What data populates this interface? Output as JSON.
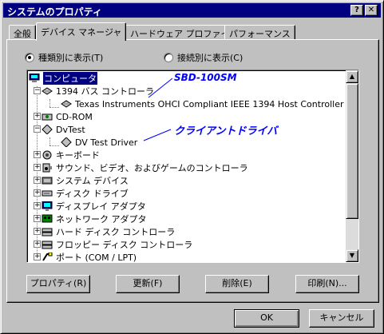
{
  "window": {
    "title": "システムのプロパティ",
    "help_btn": "?",
    "close_btn": "✕"
  },
  "tabs": [
    "全般",
    "デバイス マネージャ",
    "ハードウェア プロファイル",
    "パフォーマンス"
  ],
  "view": {
    "by_type": "種類別に表示(T)",
    "by_connection": "接続別に表示(C)"
  },
  "tree": {
    "root": "コンピュータ",
    "bus1394": "1394 バス コントローラ",
    "ti_controller": "Texas Instruments OHCI Compliant IEEE 1394 Host Controller",
    "cdrom": "CD-ROM",
    "dvtest": "DvTest",
    "dv_driver": "DV Test Driver",
    "keyboard": "キーボード",
    "sound": "サウンド、ビデオ、およびゲームのコントローラ",
    "system": "システム デバイス",
    "disk": "ディスク ドライブ",
    "display": "ディスプレイ アダプタ",
    "network": "ネットワーク アダプタ",
    "hdd_ctrl": "ハード ディスク コントローラ",
    "fdd_ctrl": "フロッピー ディスク コントローラ",
    "port": "ポート (COM / LPT)"
  },
  "annotations": {
    "sbd": "SBD-100SM",
    "client_driver": "クライアントドライバ"
  },
  "actions": {
    "properties": "プロパティ(R)",
    "refresh": "更新(F)",
    "remove": "削除(E)",
    "print": "印刷(N)..."
  },
  "dialog": {
    "ok": "OK",
    "cancel": "キャンセル"
  },
  "colors": {
    "titlebar": "#000080",
    "annotation": "#0000ff",
    "selection": "#000080"
  }
}
